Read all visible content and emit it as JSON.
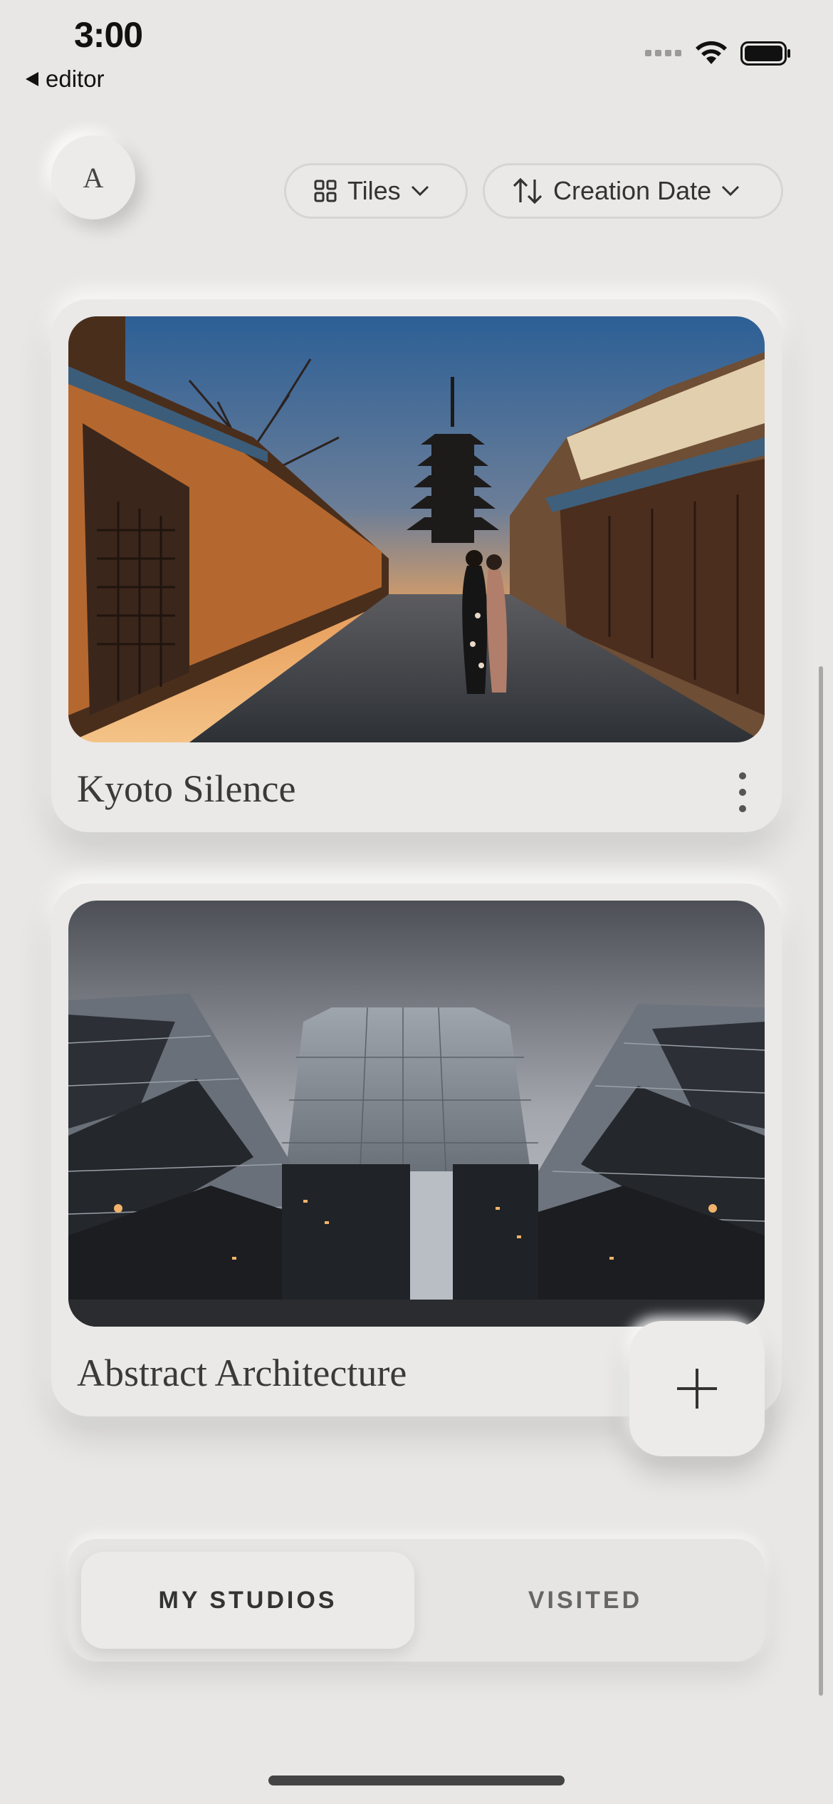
{
  "status_bar": {
    "time": "3:00",
    "back_label": "editor"
  },
  "header": {
    "avatar_initial": "A",
    "view_selector": {
      "label": "Tiles",
      "icon": "grid-icon"
    },
    "sort_selector": {
      "label": "Creation Date",
      "icon": "sort-arrows-icon"
    }
  },
  "studios": [
    {
      "title": "Kyoto Silence",
      "image": "kyoto street with pagoda at dusk"
    },
    {
      "title": "Abstract Architecture",
      "image": "glass skyscrapers under cloudy sky"
    }
  ],
  "fab": {
    "icon": "plus-icon"
  },
  "tabs": [
    {
      "label": "MY STUDIOS",
      "active": true
    },
    {
      "label": "VISITED",
      "active": false
    }
  ],
  "colors": {
    "background": "#e8e7e5",
    "text": "#333333"
  }
}
